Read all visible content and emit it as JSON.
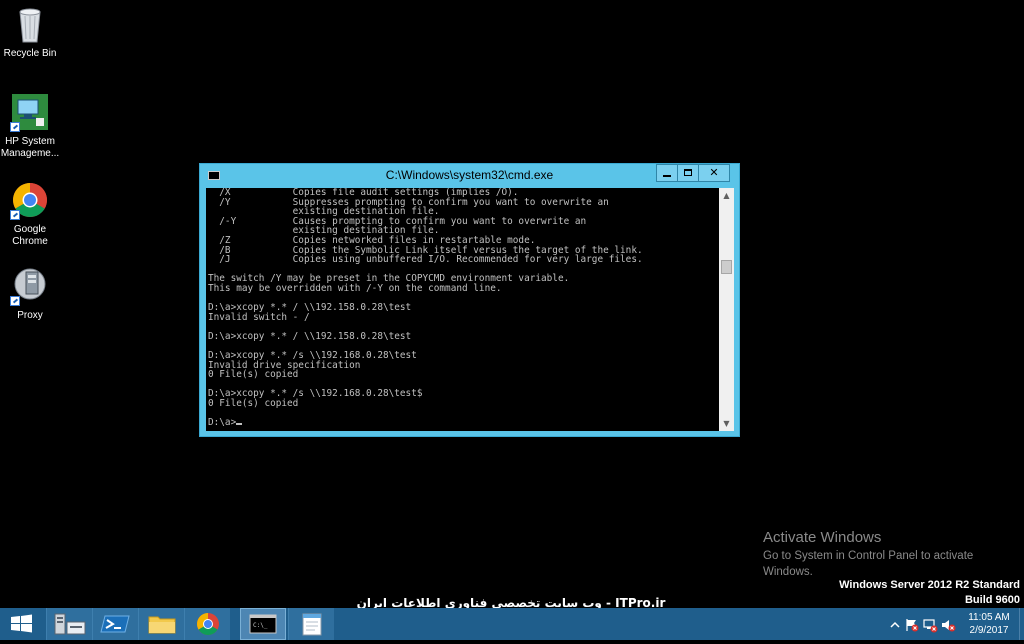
{
  "desktop": {
    "icons": [
      {
        "label": "Recycle Bin"
      },
      {
        "label": "HP System Manageme..."
      },
      {
        "label": "Google Chrome"
      },
      {
        "label": "Proxy"
      }
    ]
  },
  "cmd_window": {
    "title": "C:\\Windows\\system32\\cmd.exe",
    "console_lines": [
      "  /X           Copies file audit settings (implies /O).",
      "  /Y           Suppresses prompting to confirm you want to overwrite an",
      "               existing destination file.",
      "  /-Y          Causes prompting to confirm you want to overwrite an",
      "               existing destination file.",
      "  /Z           Copies networked files in restartable mode.",
      "  /B           Copies the Symbolic Link itself versus the target of the link.",
      "  /J           Copies using unbuffered I/O. Recommended for very large files.",
      "",
      "The switch /Y may be preset in the COPYCMD environment variable.",
      "This may be overridden with /-Y on the command line.",
      "",
      "D:\\a>xcopy *.* / \\\\192.158.0.28\\test",
      "Invalid switch - /",
      "",
      "D:\\a>xcopy *.* / \\\\192.158.0.28\\test",
      "",
      "D:\\a>xcopy *.* /s \\\\192.168.0.28\\test",
      "Invalid drive specification",
      "0 File(s) copied",
      "",
      "D:\\a>xcopy *.* /s \\\\192.168.0.28\\test$",
      "0 File(s) copied",
      ""
    ],
    "prompt": "D:\\a>"
  },
  "activation": {
    "heading": "Activate Windows",
    "message": "Go to System in Control Panel to activate Windows."
  },
  "edition": {
    "line1": "Windows Server 2012 R2 Standard",
    "line2": "Build 9600"
  },
  "watermark_site": "ITPro.ir - وب سایت تخصصی فناوری اطلاعات ایران",
  "taskbar": {
    "buttons": [
      "start-button",
      "server-manager",
      "powershell",
      "file-explorer",
      "chrome",
      "cmd",
      "notepad"
    ],
    "clock_time": "11:05 AM",
    "clock_date": "2/9/2017"
  },
  "colors": {
    "taskbar": "#1f5e8c",
    "window_frame": "#5ac4e8",
    "console_bg": "#000000",
    "console_text": "#c0c0c0"
  }
}
